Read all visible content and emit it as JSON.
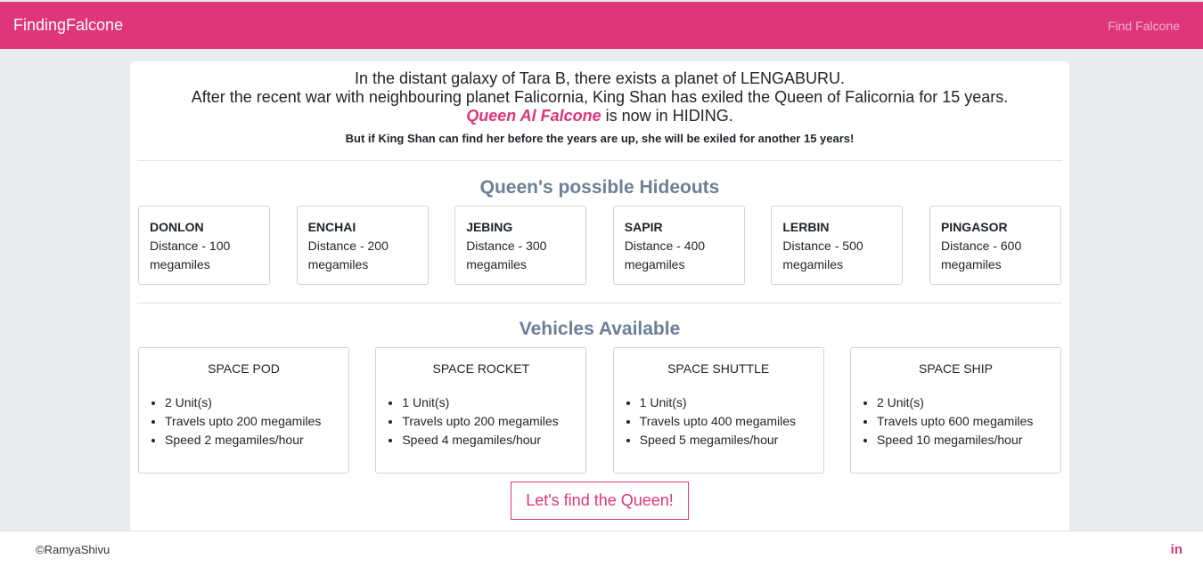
{
  "header": {
    "brand": "FindingFalcone",
    "nav_link": "Find Falcone"
  },
  "intro": {
    "line1": "In the distant galaxy of Tara B, there exists a planet of LENGABURU.",
    "line2": "After the recent war with neighbouring planet Falicornia, King Shan has exiled the Queen of Falicornia for 15 years.",
    "queen_name": "Queen Al Falcone",
    "line3_rest": " is now in HIDING.",
    "subtext": "But if King Shan can find her before the years are up, she will be exiled for another 15 years!"
  },
  "hideouts": {
    "title": "Queen's possible Hideouts",
    "planets": [
      {
        "name": "DONLON",
        "distance": "Distance - 100 megamiles"
      },
      {
        "name": "ENCHAI",
        "distance": "Distance - 200 megamiles"
      },
      {
        "name": "JEBING",
        "distance": "Distance - 300 megamiles"
      },
      {
        "name": "SAPIR",
        "distance": "Distance - 400 megamiles"
      },
      {
        "name": "LERBIN",
        "distance": "Distance - 500 megamiles"
      },
      {
        "name": "PINGASOR",
        "distance": "Distance - 600 megamiles"
      }
    ]
  },
  "vehicles": {
    "title": "Vehicles Available",
    "items": [
      {
        "name": "SPACE POD",
        "units": "2 Unit(s)",
        "range": "Travels upto 200 megamiles",
        "speed": "Speed 2 megamiles/hour"
      },
      {
        "name": "SPACE ROCKET",
        "units": "1 Unit(s)",
        "range": "Travels upto 200 megamiles",
        "speed": "Speed 4 megamiles/hour"
      },
      {
        "name": "SPACE SHUTTLE",
        "units": "1 Unit(s)",
        "range": "Travels upto 400 megamiles",
        "speed": "Speed 5 megamiles/hour"
      },
      {
        "name": "SPACE SHIP",
        "units": "2 Unit(s)",
        "range": "Travels upto 600 megamiles",
        "speed": "Speed 10 megamiles/hour"
      }
    ]
  },
  "cta_label": "Let's find the Queen!",
  "footer": {
    "copyright": "©RamyaShivu",
    "linkedin_icon_text": "in"
  },
  "colors": {
    "brand": "#de357b",
    "section_title": "#6b7f96",
    "background": "#e9ecef"
  }
}
